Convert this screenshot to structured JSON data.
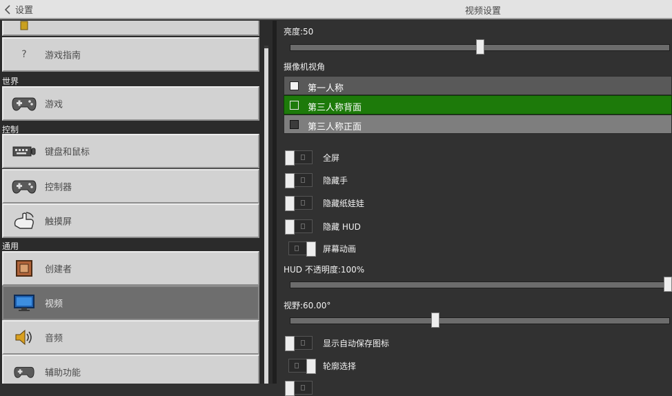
{
  "header": {
    "back_label": "设置",
    "title": "视频设置"
  },
  "sidebar": {
    "items": [
      {
        "label": "",
        "icon": "book-icon"
      },
      {
        "label": "游戏指南",
        "icon": "question-icon"
      },
      {
        "label": "游戏",
        "icon": "gamepad-icon"
      },
      {
        "label": "键盘和鼠标",
        "icon": "keyboard-icon"
      },
      {
        "label": "控制器",
        "icon": "gamepad-icon"
      },
      {
        "label": "触摸屏",
        "icon": "touch-hand-icon"
      },
      {
        "label": "创建者",
        "icon": "creator-icon"
      },
      {
        "label": "视频",
        "icon": "monitor-icon"
      },
      {
        "label": "音频",
        "icon": "speaker-icon"
      },
      {
        "label": "辅助功能",
        "icon": "gamepad-icon"
      }
    ],
    "sections": {
      "world": "世界",
      "controls": "控制",
      "general": "通用"
    },
    "selected": "视频"
  },
  "video": {
    "brightness_label": "亮度:50",
    "brightness_value": 50,
    "camera_label": "摄像机视角",
    "camera_options": [
      "第一人称",
      "第三人称背面",
      "第三人称正面"
    ],
    "camera_selected": "第三人称背面",
    "toggles": [
      {
        "label": "全屏",
        "on": false
      },
      {
        "label": "隐藏手",
        "on": false
      },
      {
        "label": "隐藏纸娃娃",
        "on": false
      },
      {
        "label": "隐藏 HUD",
        "on": false
      },
      {
        "label": "屏幕动画",
        "on": true
      }
    ],
    "hud_opacity_label": "HUD 不透明度:100%",
    "hud_opacity_value": 100,
    "fov_label": "视野:60.00°",
    "fov_fraction": 0.38,
    "toggles2": [
      {
        "label": "显示自动保存图标",
        "on": false
      },
      {
        "label": "轮廓选择",
        "on": true
      }
    ]
  },
  "colors": {
    "selected_option": "#1d7a0a",
    "option_bg": "#585858",
    "option_bg_alt": "#7e7e7e"
  }
}
